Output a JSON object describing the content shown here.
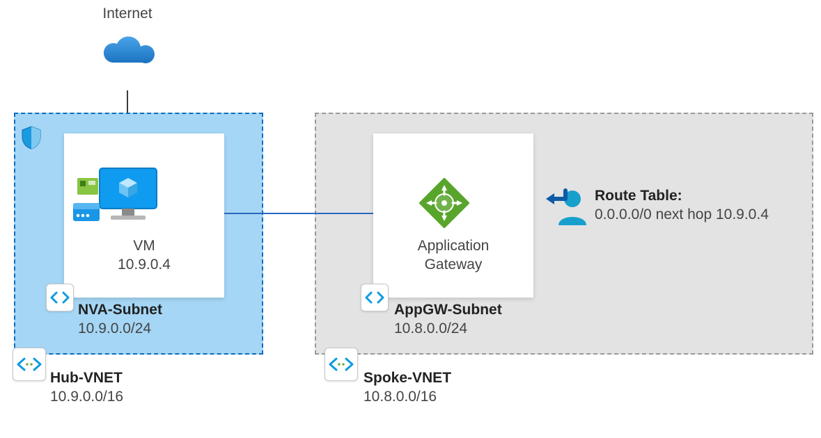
{
  "internet": {
    "label": "Internet"
  },
  "hub_vnet": {
    "name": "Hub-VNET",
    "cidr": "10.9.0.0/16",
    "subnet": {
      "name": "NVA-Subnet",
      "cidr": "10.9.0.0/24",
      "vm": {
        "label": "VM",
        "ip": "10.9.0.4"
      }
    }
  },
  "spoke_vnet": {
    "name": "Spoke-VNET",
    "cidr": "10.8.0.0/16",
    "subnet": {
      "name": "AppGW-Subnet",
      "cidr": "10.8.0.0/24",
      "appgw": {
        "label_line1": "Application",
        "label_line2": "Gateway"
      }
    },
    "route_table": {
      "title": "Route Table:",
      "entry": "0.0.0.0/0 next hop 10.9.0.4"
    }
  }
}
